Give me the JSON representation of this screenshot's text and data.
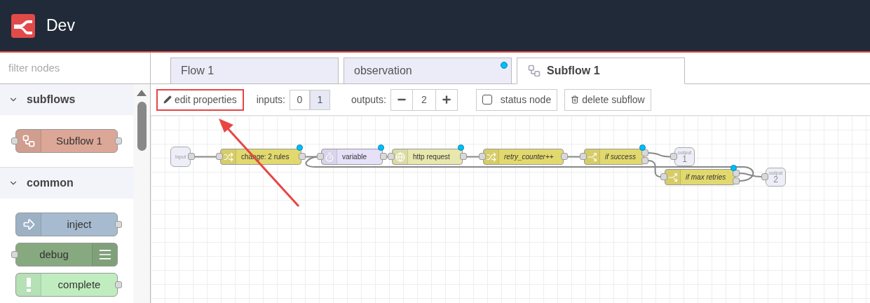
{
  "header": {
    "title": "Dev"
  },
  "palette": {
    "filter_placeholder": "filter nodes",
    "categories": [
      {
        "name": "subflows",
        "expanded": true,
        "nodes": [
          {
            "label": "Subflow 1",
            "kind": "subflow",
            "color": "#dca797",
            "has_input": true,
            "has_output": true
          }
        ]
      },
      {
        "name": "common",
        "expanded": true,
        "nodes": [
          {
            "label": "inject",
            "kind": "inject",
            "color": "#a6bbcf",
            "has_input": false,
            "has_output": true
          },
          {
            "label": "debug",
            "kind": "debug",
            "color": "#87a980",
            "has_input": true,
            "has_output": false
          },
          {
            "label": "complete",
            "kind": "complete",
            "color": "#c0edc0",
            "has_input": false,
            "has_output": true
          }
        ]
      }
    ]
  },
  "tabs": [
    {
      "label": "Flow 1",
      "kind": "flow",
      "selected": false,
      "changed": false
    },
    {
      "label": "observation",
      "kind": "flow",
      "selected": false,
      "changed": true
    },
    {
      "label": "Subflow 1",
      "kind": "subflow",
      "selected": true,
      "changed": false
    }
  ],
  "toolbar": {
    "edit_button": {
      "label": "edit properties",
      "highlighted": true
    },
    "inputs": {
      "label": "inputs:",
      "options": [
        {
          "label": "0",
          "selected": false
        },
        {
          "label": "1",
          "selected": true
        }
      ]
    },
    "outputs": {
      "label": "outputs:",
      "value": "2"
    },
    "status_node": {
      "label": "status node",
      "checked": false
    },
    "delete_button": {
      "label": "delete subflow"
    }
  },
  "canvas": {
    "nodes": [
      {
        "kind": "port",
        "label": "input"
      },
      {
        "kind": "change",
        "label": "change: 2 rules",
        "color": "#e2d96e",
        "italic": false,
        "changed": true,
        "two_outputs": false
      },
      {
        "kind": "delay",
        "label": "variable",
        "color": "#e6e0f8",
        "italic": false,
        "changed": true,
        "two_outputs": false
      },
      {
        "kind": "http",
        "label": "http request",
        "color": "#e7e7ae",
        "italic": false,
        "changed": true,
        "two_outputs": false
      },
      {
        "kind": "change",
        "label": "retry_counter++",
        "color": "#e2d96e",
        "italic": true,
        "changed": false,
        "two_outputs": false
      },
      {
        "kind": "switch",
        "label": "if success",
        "color": "#e2d96e",
        "italic": true,
        "changed": true,
        "two_outputs": true
      },
      {
        "kind": "port",
        "label": "output",
        "number": "1"
      },
      {
        "kind": "switch",
        "label": "if max retries",
        "color": "#e2d96e",
        "italic": true,
        "changed": true,
        "two_outputs": true
      },
      {
        "kind": "port",
        "label": "output",
        "number": "2"
      }
    ]
  }
}
